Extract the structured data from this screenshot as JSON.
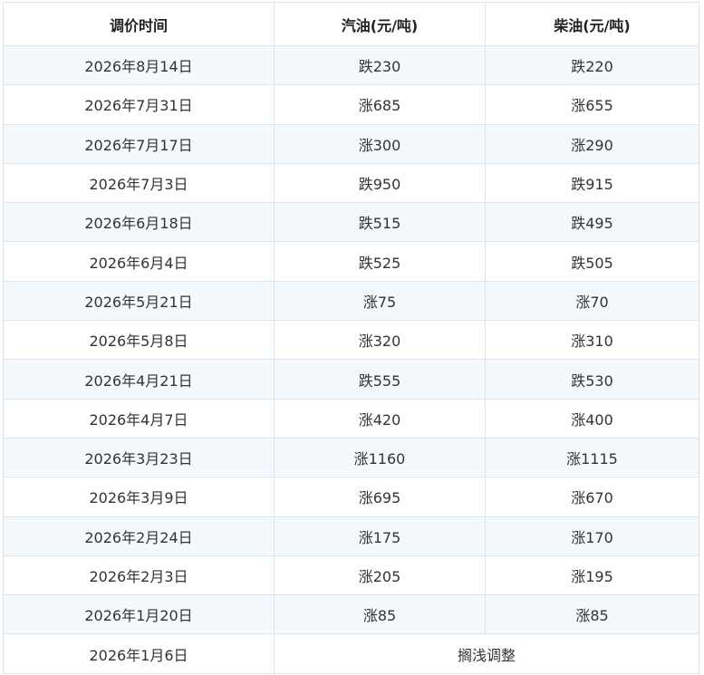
{
  "table": {
    "headers": [
      "调价时间",
      "汽油(元/吨)",
      "柴油(元/吨)"
    ],
    "rows": [
      {
        "date": "2026年8月14日",
        "gasoline": "跌230",
        "diesel": "跌220",
        "direction": "down"
      },
      {
        "date": "2026年7月31日",
        "gasoline": "涨685",
        "diesel": "涨655",
        "direction": "up"
      },
      {
        "date": "2026年7月17日",
        "gasoline": "涨300",
        "diesel": "涨290",
        "direction": "up"
      },
      {
        "date": "2026年7月3日",
        "gasoline": "跌950",
        "diesel": "跌915",
        "direction": "down"
      },
      {
        "date": "2026年6月18日",
        "gasoline": "跌515",
        "diesel": "跌495",
        "direction": "down"
      },
      {
        "date": "2026年6月4日",
        "gasoline": "跌525",
        "diesel": "跌505",
        "direction": "down"
      },
      {
        "date": "2026年5月21日",
        "gasoline": "涨75",
        "diesel": "涨70",
        "direction": "up"
      },
      {
        "date": "2026年5月8日",
        "gasoline": "涨320",
        "diesel": "涨310",
        "direction": "up"
      },
      {
        "date": "2026年4月21日",
        "gasoline": "跌555",
        "diesel": "跌530",
        "direction": "down"
      },
      {
        "date": "2026年4月7日",
        "gasoline": "涨420",
        "diesel": "涨400",
        "direction": "up"
      },
      {
        "date": "2026年3月23日",
        "gasoline": "涨1160",
        "diesel": "涨1115",
        "direction": "up"
      },
      {
        "date": "2026年3月9日",
        "gasoline": "涨695",
        "diesel": "涨670",
        "direction": "up"
      },
      {
        "date": "2026年2月24日",
        "gasoline": "涨175",
        "diesel": "涨170",
        "direction": "up"
      },
      {
        "date": "2026年2月3日",
        "gasoline": "涨205",
        "diesel": "涨195",
        "direction": "up"
      },
      {
        "date": "2026年1月20日",
        "gasoline": "涨85",
        "diesel": "涨85",
        "direction": "up"
      }
    ],
    "final_row": {
      "date": "2026年1月6日",
      "note": "搁浅调整"
    },
    "colors": {
      "rise": "#c8264c",
      "fall": "#2e8b1e",
      "border": "#dde4ec",
      "stripe": "#f4f9fd"
    }
  }
}
